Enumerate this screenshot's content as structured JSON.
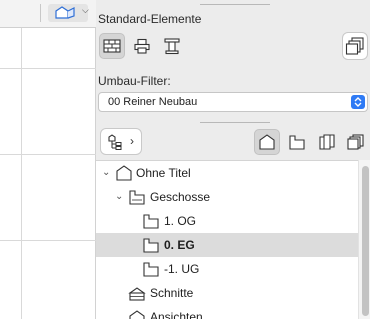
{
  "toolbox": {
    "title": "Standard-Elemente",
    "tools": [
      {
        "icon": "wall-icon",
        "active": true
      },
      {
        "icon": "printer-icon",
        "active": false
      },
      {
        "icon": "column-icon",
        "active": false
      }
    ],
    "big_button_icon": "stacked-layers-icon"
  },
  "renovation_filter": {
    "label": "Umbau-Filter:",
    "value": "00 Reiner Neubau"
  },
  "navigator": {
    "maps": [
      {
        "icon": "project-map-icon",
        "active": true
      },
      {
        "icon": "view-map-icon",
        "active": false
      },
      {
        "icon": "layout-book-icon",
        "active": false
      },
      {
        "icon": "publisher-sets-icon",
        "active": false
      }
    ],
    "tree": [
      {
        "label": "Ohne Titel",
        "level": 0,
        "expanded": true,
        "icon": "project-house-icon",
        "selected": false,
        "bold": false
      },
      {
        "label": "Geschosse",
        "level": 1,
        "expanded": true,
        "icon": "stories-folder-icon",
        "selected": false,
        "bold": false
      },
      {
        "label": "1. OG",
        "level": 2,
        "icon": "story-icon",
        "selected": false,
        "bold": false
      },
      {
        "label": "0. EG",
        "level": 2,
        "icon": "story-icon",
        "selected": true,
        "bold": true
      },
      {
        "label": "-1. UG",
        "level": 2,
        "icon": "story-icon",
        "selected": false,
        "bold": false
      },
      {
        "label": "Schnitte",
        "level": 1,
        "icon": "sections-icon",
        "selected": false,
        "bold": false
      },
      {
        "label": "Ansichten",
        "level": 1,
        "icon": "elevations-icon",
        "selected": false,
        "bold": false
      }
    ]
  },
  "colors": {
    "accent": "#2f7bf5",
    "selection": "#dcdcdc",
    "panel_bg": "#ececec"
  }
}
